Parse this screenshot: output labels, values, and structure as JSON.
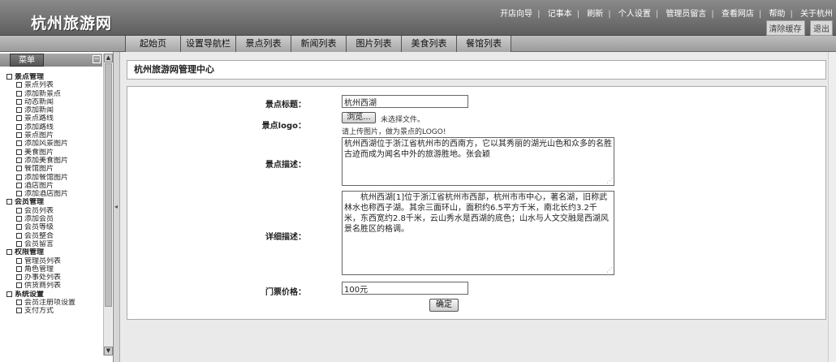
{
  "header": {
    "site_title": "杭州旅游网",
    "top_links": [
      "开店向导",
      "记事本",
      "刷新",
      "个人设置",
      "管理员留言",
      "查看网店",
      "帮助",
      "关于杭州"
    ],
    "clear_cache": "清除缓存",
    "logout": "退出"
  },
  "nav": {
    "tabs": [
      "起始页",
      "设置导航栏",
      "景点列表",
      "新闻列表",
      "图片列表",
      "美食列表",
      "餐馆列表"
    ]
  },
  "sidebar": {
    "menu_label": "菜单",
    "items": [
      {
        "label": "景点管理",
        "section": true
      },
      {
        "label": "景点列表"
      },
      {
        "label": "添加新景点"
      },
      {
        "label": "动态新闻"
      },
      {
        "label": "添加新闻"
      },
      {
        "label": "景点路线"
      },
      {
        "label": "添加路线"
      },
      {
        "label": "景点图片"
      },
      {
        "label": "添加风景图片"
      },
      {
        "label": "美食图片"
      },
      {
        "label": "添加美食图片"
      },
      {
        "label": "餐馆图片"
      },
      {
        "label": "添加餐馆图片"
      },
      {
        "label": "酒店图片"
      },
      {
        "label": "添加酒店图片"
      },
      {
        "label": "会员管理",
        "section": true
      },
      {
        "label": "会员列表"
      },
      {
        "label": "添加会员"
      },
      {
        "label": "会员等级"
      },
      {
        "label": "会员整合"
      },
      {
        "label": "会员留言"
      },
      {
        "label": "权限管理",
        "section": true
      },
      {
        "label": "管理员列表"
      },
      {
        "label": "角色管理"
      },
      {
        "label": "办事处列表"
      },
      {
        "label": "供货商列表"
      },
      {
        "label": "系统设置",
        "section": true
      },
      {
        "label": "会员注册项设置"
      },
      {
        "label": "支付方式"
      }
    ]
  },
  "main": {
    "page_title": "杭州旅游网管理中心",
    "form": {
      "title_label": "景点标题：",
      "title_value": "杭州西湖",
      "logo_label": "景点logo：",
      "browse_button": "浏览...",
      "no_file": "未选择文件。",
      "logo_hint": "请上传图片，做为景点的LOGO!",
      "desc_label": "景点描述：",
      "desc_value": "杭州西湖位于浙江省杭州市的西南方，它以其秀丽的湖光山色和众多的名胜古迹而成为闻名中外的旅游胜地。张会颖",
      "detail_label": "详细描述：",
      "detail_value": "　　杭州西湖[1]位于浙江省杭州市西部，杭州市市中心，著名湖，旧称武林水也称西子湖。其余三面环山，面积约6.5平方千米，南北长约3.2千米，东西宽约2.8千米，云山秀水是西湖的底色；山水与人文交融是西湖风景名胜区的格调。",
      "price_label": "门票价格：",
      "price_value": "100元",
      "submit_button": "确定"
    }
  }
}
